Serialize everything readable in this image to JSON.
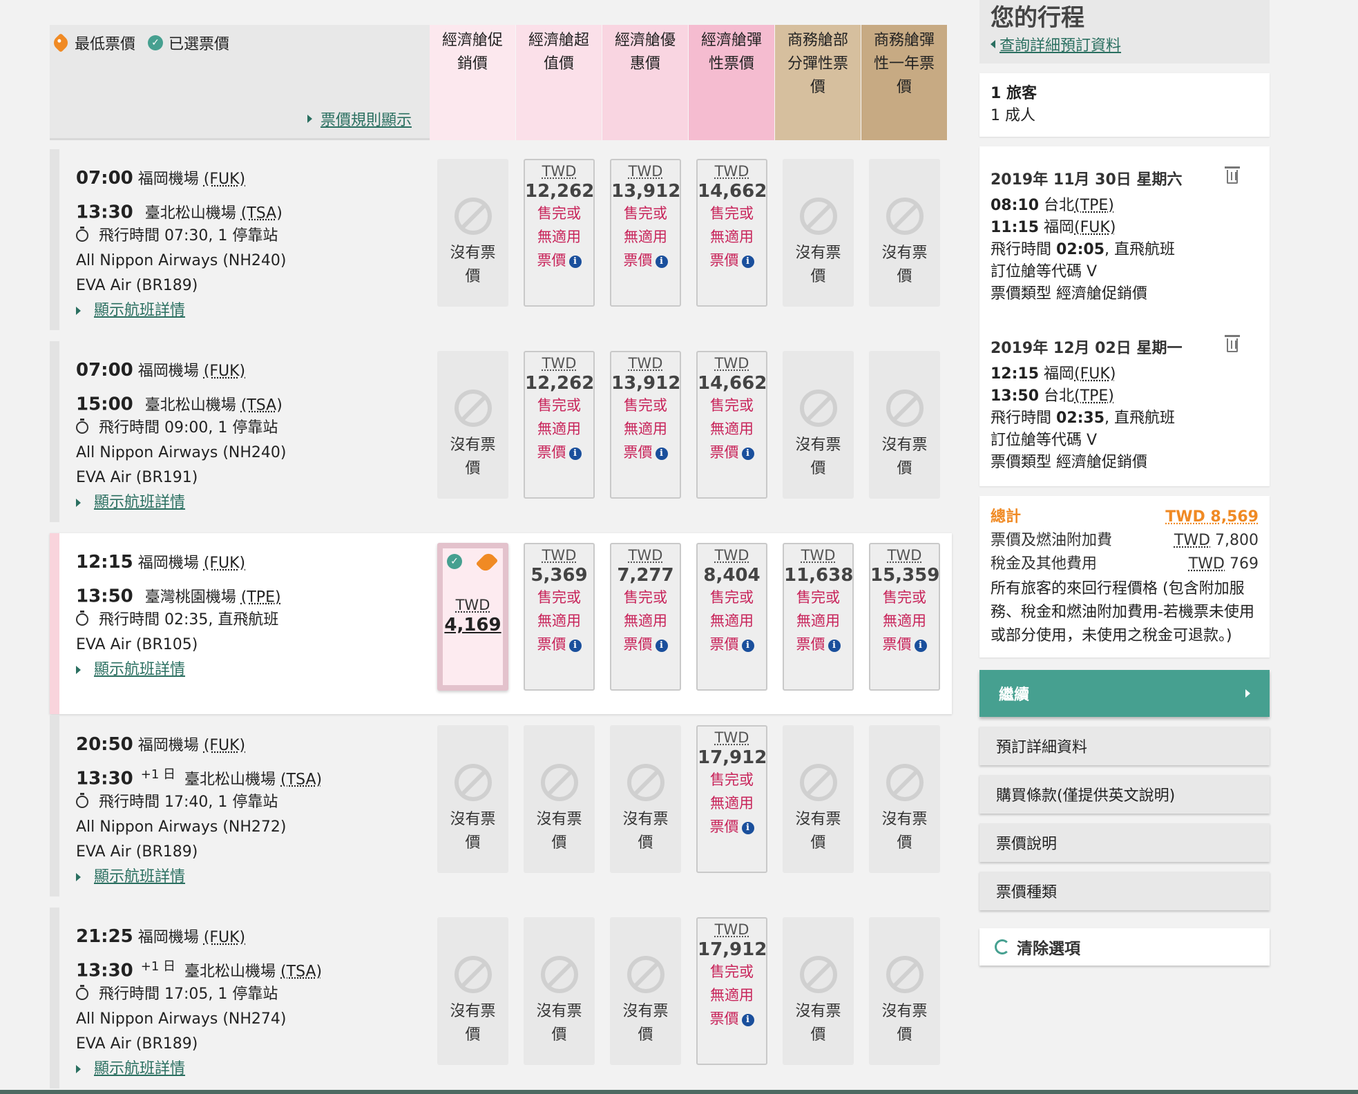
{
  "legend": {
    "lowest": "最低票價",
    "selected": "已選票價"
  },
  "rules_link": "票價規則顯示",
  "columns": [
    {
      "label": "經濟艙促銷價",
      "color": "#fce8ee"
    },
    {
      "label": "經濟艙超值價",
      "color": "#fbe0e9"
    },
    {
      "label": "經濟艙優惠價",
      "color": "#f9d5e1"
    },
    {
      "label": "經濟艙彈性票價",
      "color": "#f5bcd0"
    },
    {
      "label": "商務艙部分彈性票價",
      "color": "#d6bf9e"
    },
    {
      "label": "商務艙彈性一年票價",
      "color": "#c7aa83"
    }
  ],
  "no_fare_text": "沒有票價",
  "sold_lines": [
    "售完或",
    "無適用",
    "票價"
  ],
  "currency": "TWD",
  "details_link": "顯示航班詳情",
  "flights": [
    {
      "dep_time": "07:00",
      "dep_airport": "福岡機場",
      "dep_code": "(FUK)",
      "arr_time": "13:30",
      "arr_plus": "",
      "arr_airport": "臺北松山機場",
      "arr_code": "(TSA)",
      "duration_label": "飛行時間",
      "duration": "07:30",
      "stops": "1 停靠站",
      "carriers": [
        "All Nippon Airways (NH240)",
        "EVA Air (BR189)"
      ],
      "fares": [
        null,
        "12,262",
        "13,912",
        "14,662",
        null,
        null
      ]
    },
    {
      "dep_time": "07:00",
      "dep_airport": "福岡機場",
      "dep_code": "(FUK)",
      "arr_time": "15:00",
      "arr_plus": "",
      "arr_airport": "臺北松山機場",
      "arr_code": "(TSA)",
      "duration_label": "飛行時間",
      "duration": "09:00",
      "stops": "1 停靠站",
      "carriers": [
        "All Nippon Airways (NH240)",
        "EVA Air (BR191)"
      ],
      "fares": [
        null,
        "12,262",
        "13,912",
        "14,662",
        null,
        null
      ]
    },
    {
      "dep_time": "12:15",
      "dep_airport": "福岡機場",
      "dep_code": "(FUK)",
      "arr_time": "13:50",
      "arr_plus": "",
      "arr_airport": "臺灣桃園機場",
      "arr_code": "(TPE)",
      "duration_label": "飛行時間",
      "duration": "02:35",
      "stops": "直飛航班",
      "carriers": [
        "EVA Air (BR105)"
      ],
      "selected": true,
      "chosen_fare": "4,169",
      "fares": [
        "4,169",
        "5,369",
        "7,277",
        "8,404",
        "11,638",
        "15,359"
      ]
    },
    {
      "dep_time": "20:50",
      "dep_airport": "福岡機場",
      "dep_code": "(FUK)",
      "arr_time": "13:30",
      "arr_plus": "+1 日",
      "arr_airport": "臺北松山機場",
      "arr_code": "(TSA)",
      "duration_label": "飛行時間",
      "duration": "17:40",
      "stops": "1 停靠站",
      "carriers": [
        "All Nippon Airways (NH272)",
        "EVA Air (BR189)"
      ],
      "fares": [
        null,
        null,
        null,
        "17,912",
        null,
        null
      ]
    },
    {
      "dep_time": "21:25",
      "dep_airport": "福岡機場",
      "dep_code": "(FUK)",
      "arr_time": "13:30",
      "arr_plus": "+1 日",
      "arr_airport": "臺北松山機場",
      "arr_code": "(TSA)",
      "duration_label": "飛行時間",
      "duration": "17:05",
      "stops": "1 停靠站",
      "carriers": [
        "All Nippon Airways (NH274)",
        "EVA Air (BR189)"
      ],
      "fares": [
        null,
        null,
        null,
        "17,912",
        null,
        null
      ]
    }
  ],
  "panel": {
    "title": "您的行程",
    "back_link": "查詢詳細預訂資料",
    "passengers": {
      "count": "1 旅客",
      "adults": "1 成人"
    },
    "segments": [
      {
        "date": "2019年 11月 30日 星期六",
        "dep_time": "08:10",
        "dep_city": "台北",
        "dep_code": "(TPE)",
        "arr_time": "11:15",
        "arr_city": "福岡",
        "arr_code": "(FUK)",
        "duration_label": "飛行時間",
        "duration": "02:05",
        "type": "直飛航班",
        "booking_class": "訂位艙等代碼 V",
        "fare_type": "票價類型 經濟艙促銷價"
      },
      {
        "date": "2019年 12月 02日 星期一",
        "dep_time": "12:15",
        "dep_city": "福岡",
        "dep_code": "(FUK)",
        "arr_time": "13:50",
        "arr_city": "台北",
        "arr_code": "(TPE)",
        "duration_label": "飛行時間",
        "duration": "02:35",
        "type": "直飛航班",
        "booking_class": "訂位艙等代碼 V",
        "fare_type": "票價類型 經濟艙促銷價"
      }
    ],
    "totals": {
      "total_label": "總計",
      "total_value": "TWD 8,569",
      "fare_label": "票價及燃油附加費",
      "fare_value": "7,800",
      "tax_label": "稅金及其他費用",
      "tax_value": "769",
      "note": "所有旅客的來回行程價格 (包含附加服務、稅金和燃油附加費用-若機票未使用或部分使用，未使用之稅金可退款。)"
    },
    "continue_label": "繼續",
    "buttons": [
      "預訂詳細資料",
      "購買條款(僅提供英文說明)",
      "票價說明",
      "票價種類"
    ],
    "clear_label": "清除選項"
  }
}
